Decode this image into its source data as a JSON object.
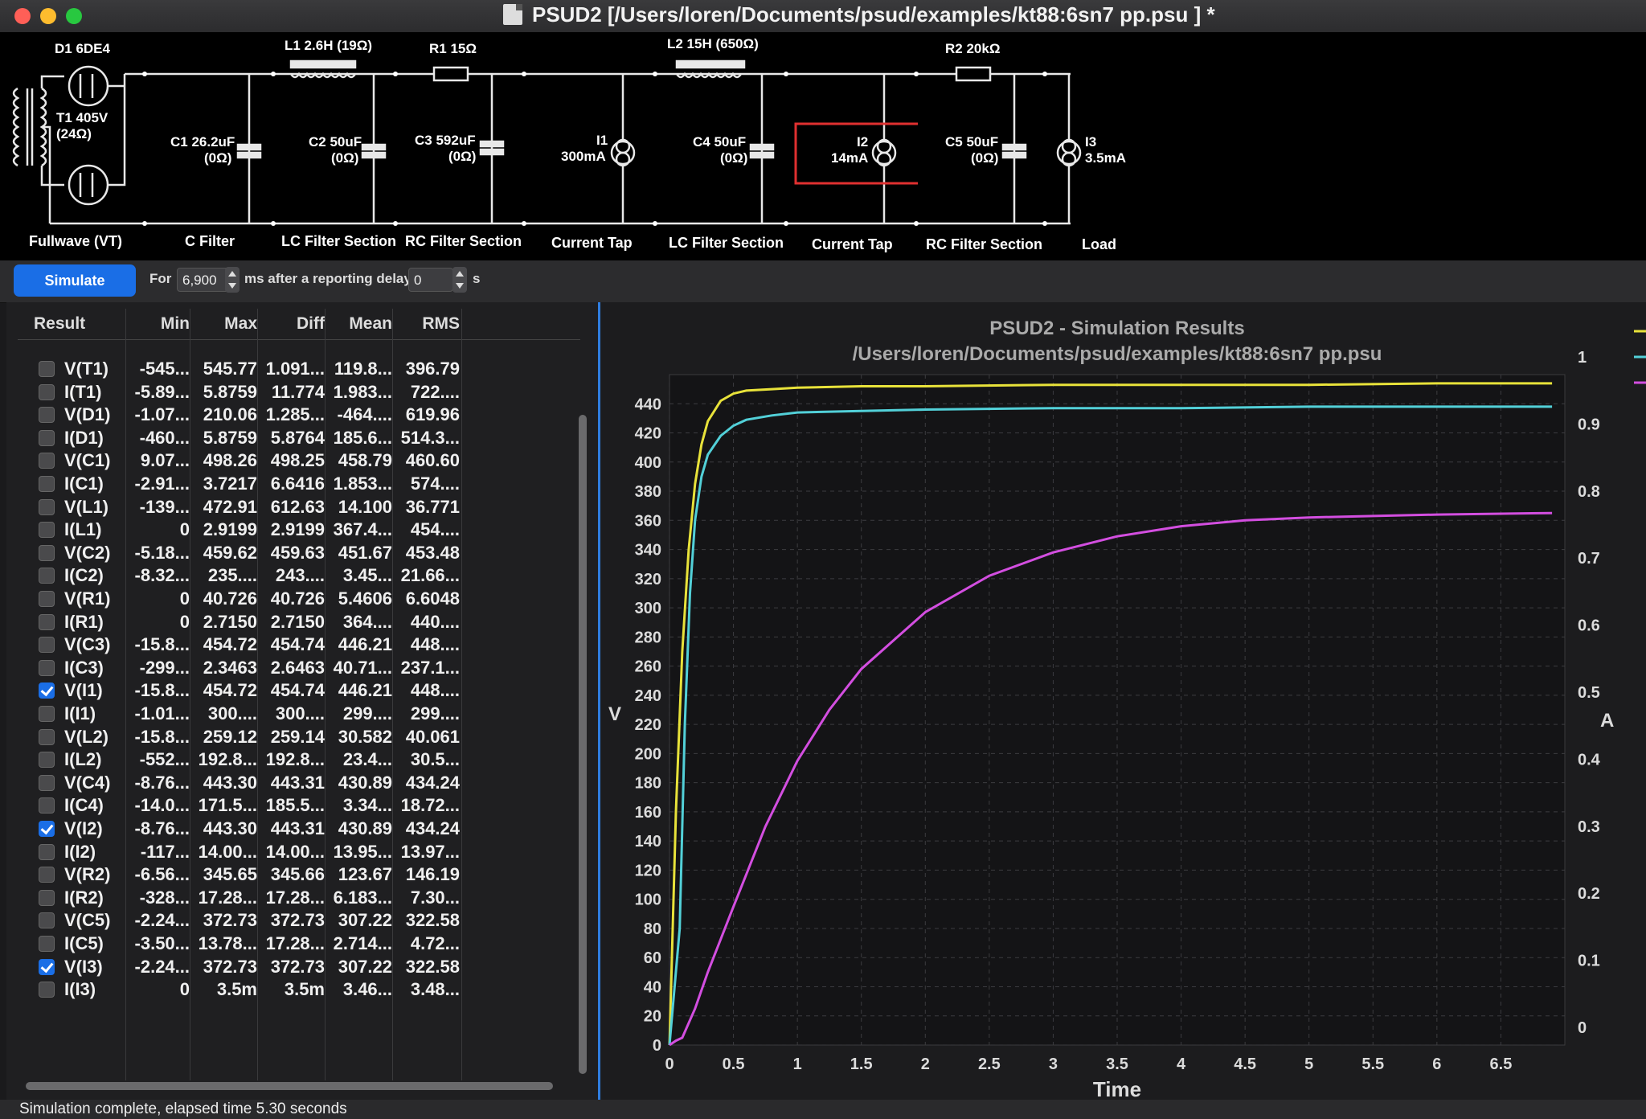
{
  "window": {
    "title": "PSUD2  [/Users/loren/Documents/psud/examples/kt88:6sn7 pp.psu ] *"
  },
  "schematic": {
    "labels": {
      "d1": "D1 6DE4",
      "t1_line1": "T1 405V",
      "t1_line2": "(24Ω)",
      "l1": "L1 2.6H (19Ω)",
      "r1": "R1 15Ω",
      "l2": "L2 15H (650Ω)",
      "r2": "R2 20kΩ",
      "c1_line1": "C1 26.2uF",
      "c1_line2": "(0Ω)",
      "c2_line1": "C2 50uF",
      "c2_line2": "(0Ω)",
      "c3_line1": "C3 592uF",
      "c3_line2": "(0Ω)",
      "i1_line1": "I1",
      "i1_line2": "300mA",
      "c4_line1": "C4 50uF",
      "c4_line2": "(0Ω)",
      "i2_line1": "I2",
      "i2_line2": "14mA",
      "c5_line1": "C5 50uF",
      "c5_line2": "(0Ω)",
      "i3_line1": "I3",
      "i3_line2": "3.5mA"
    },
    "sections": [
      "Fullwave (VT)",
      "C Filter",
      "LC Filter Section",
      "RC Filter Section",
      "Current Tap",
      "LC Filter Section",
      "Current Tap",
      "RC Filter Section",
      "Load"
    ]
  },
  "toolbar": {
    "simulate_label": "Simulate",
    "for_label": "For",
    "duration_value": "6,900",
    "ms_label": "ms after a reporting delay of",
    "delay_value": "0",
    "s_label": "s"
  },
  "table": {
    "headers": [
      "Result",
      "Min",
      "Max",
      "Diff",
      "Mean",
      "RMS"
    ],
    "rows": [
      {
        "name": "V(T1)",
        "min": "-545...",
        "max": "545.77",
        "diff": "1.091...",
        "mean": "119.8...",
        "rms": "396.79",
        "checked": false
      },
      {
        "name": "I(T1)",
        "min": "-5.89...",
        "max": "5.8759",
        "diff": "11.774",
        "mean": "1.983...",
        "rms": "722....",
        "checked": false
      },
      {
        "name": "V(D1)",
        "min": "-1.07...",
        "max": "210.06",
        "diff": "1.285...",
        "mean": "-464....",
        "rms": "619.96",
        "checked": false
      },
      {
        "name": "I(D1)",
        "min": "-460...",
        "max": "5.8759",
        "diff": "5.8764",
        "mean": "185.6...",
        "rms": "514.3...",
        "checked": false
      },
      {
        "name": "V(C1)",
        "min": "9.07...",
        "max": "498.26",
        "diff": "498.25",
        "mean": "458.79",
        "rms": "460.60",
        "checked": false
      },
      {
        "name": "I(C1)",
        "min": "-2.91...",
        "max": "3.7217",
        "diff": "6.6416",
        "mean": "1.853...",
        "rms": "574....",
        "checked": false
      },
      {
        "name": "V(L1)",
        "min": "-139...",
        "max": "472.91",
        "diff": "612.63",
        "mean": "14.100",
        "rms": "36.771",
        "checked": false
      },
      {
        "name": "I(L1)",
        "min": "0",
        "max": "2.9199",
        "diff": "2.9199",
        "mean": "367.4...",
        "rms": "454....",
        "checked": false
      },
      {
        "name": "V(C2)",
        "min": "-5.18...",
        "max": "459.62",
        "diff": "459.63",
        "mean": "451.67",
        "rms": "453.48",
        "checked": false
      },
      {
        "name": "I(C2)",
        "min": "-8.32...",
        "max": "235....",
        "diff": "243....",
        "mean": "3.45...",
        "rms": "21.66...",
        "checked": false
      },
      {
        "name": "V(R1)",
        "min": "0",
        "max": "40.726",
        "diff": "40.726",
        "mean": "5.4606",
        "rms": "6.6048",
        "checked": false
      },
      {
        "name": "I(R1)",
        "min": "0",
        "max": "2.7150",
        "diff": "2.7150",
        "mean": "364....",
        "rms": "440....",
        "checked": false
      },
      {
        "name": "V(C3)",
        "min": "-15.8...",
        "max": "454.72",
        "diff": "454.74",
        "mean": "446.21",
        "rms": "448....",
        "checked": false
      },
      {
        "name": "I(C3)",
        "min": "-299...",
        "max": "2.3463",
        "diff": "2.6463",
        "mean": "40.71...",
        "rms": "237.1...",
        "checked": false
      },
      {
        "name": "V(I1)",
        "min": "-15.8...",
        "max": "454.72",
        "diff": "454.74",
        "mean": "446.21",
        "rms": "448....",
        "checked": true
      },
      {
        "name": "I(I1)",
        "min": "-1.01...",
        "max": "300....",
        "diff": "300....",
        "mean": "299....",
        "rms": "299....",
        "checked": false
      },
      {
        "name": "V(L2)",
        "min": "-15.8...",
        "max": "259.12",
        "diff": "259.14",
        "mean": "30.582",
        "rms": "40.061",
        "checked": false
      },
      {
        "name": "I(L2)",
        "min": "-552...",
        "max": "192.8...",
        "diff": "192.8...",
        "mean": "23.4...",
        "rms": "30.5...",
        "checked": false
      },
      {
        "name": "V(C4)",
        "min": "-8.76...",
        "max": "443.30",
        "diff": "443.31",
        "mean": "430.89",
        "rms": "434.24",
        "checked": false
      },
      {
        "name": "I(C4)",
        "min": "-14.0...",
        "max": "171.5...",
        "diff": "185.5...",
        "mean": "3.34...",
        "rms": "18.72...",
        "checked": false
      },
      {
        "name": "V(I2)",
        "min": "-8.76...",
        "max": "443.30",
        "diff": "443.31",
        "mean": "430.89",
        "rms": "434.24",
        "checked": true
      },
      {
        "name": "I(I2)",
        "min": "-117...",
        "max": "14.00...",
        "diff": "14.00...",
        "mean": "13.95...",
        "rms": "13.97...",
        "checked": false
      },
      {
        "name": "V(R2)",
        "min": "-6.56...",
        "max": "345.65",
        "diff": "345.66",
        "mean": "123.67",
        "rms": "146.19",
        "checked": false
      },
      {
        "name": "I(R2)",
        "min": "-328...",
        "max": "17.28...",
        "diff": "17.28...",
        "mean": "6.183...",
        "rms": "7.30...",
        "checked": false
      },
      {
        "name": "V(C5)",
        "min": "-2.24...",
        "max": "372.73",
        "diff": "372.73",
        "mean": "307.22",
        "rms": "322.58",
        "checked": false
      },
      {
        "name": "I(C5)",
        "min": "-3.50...",
        "max": "13.78...",
        "diff": "17.28...",
        "mean": "2.714...",
        "rms": "4.72...",
        "checked": false
      },
      {
        "name": "V(I3)",
        "min": "-2.24...",
        "max": "372.73",
        "diff": "372.73",
        "mean": "307.22",
        "rms": "322.58",
        "checked": true
      },
      {
        "name": "I(I3)",
        "min": "0",
        "max": "3.5m",
        "diff": "3.5m",
        "mean": "3.46...",
        "rms": "3.48...",
        "checked": false
      }
    ]
  },
  "chart_data": {
    "type": "line",
    "title": "PSUD2 - Simulation Results",
    "subtitle": "/Users/loren/Documents/psud/examples/kt88:6sn7 pp.psu",
    "xlabel": "Time",
    "ylabel": "V",
    "y2label": "A",
    "xlim": [
      0,
      7
    ],
    "ylim": [
      0,
      460
    ],
    "y2lim": [
      0,
      1.0
    ],
    "grid": true,
    "x_ticks": [
      "0",
      "0.5",
      "1",
      "1.5",
      "2",
      "2.5",
      "3",
      "3.5",
      "4",
      "4.5",
      "5",
      "5.5",
      "6",
      "6.5"
    ],
    "y_ticks": [
      "0",
      "20",
      "40",
      "60",
      "80",
      "100",
      "120",
      "140",
      "160",
      "180",
      "200",
      "220",
      "240",
      "260",
      "280",
      "300",
      "320",
      "340",
      "360",
      "380",
      "400",
      "420",
      "440"
    ],
    "y2_ticks": [
      "0",
      "0.1",
      "0.2",
      "0.3",
      "0.4",
      "0.5",
      "0.6",
      "0.7",
      "0.8",
      "0.9",
      "1"
    ],
    "series": [
      {
        "color": "#e8e23a",
        "x": [
          0,
          0.05,
          0.1,
          0.15,
          0.2,
          0.25,
          0.3,
          0.4,
          0.5,
          0.6,
          0.8,
          1,
          1.5,
          2,
          3,
          4,
          5,
          6,
          6.9
        ],
        "y": [
          0,
          160,
          270,
          340,
          385,
          412,
          428,
          442,
          447,
          449,
          450,
          451,
          452,
          452,
          453,
          453,
          453,
          454,
          454
        ]
      },
      {
        "color": "#52d0d8",
        "x": [
          0,
          0.08,
          0.12,
          0.16,
          0.2,
          0.25,
          0.3,
          0.4,
          0.5,
          0.6,
          0.8,
          1,
          1.5,
          2,
          3,
          4,
          5,
          6,
          6.9
        ],
        "y": [
          0,
          80,
          220,
          310,
          360,
          390,
          405,
          418,
          425,
          429,
          432,
          434,
          435,
          436,
          437,
          437,
          438,
          438,
          438
        ]
      },
      {
        "color": "#d34ee0",
        "x": [
          0,
          0.05,
          0.1,
          0.2,
          0.3,
          0.5,
          0.75,
          1,
          1.25,
          1.5,
          2,
          2.5,
          3,
          3.5,
          4,
          4.5,
          5,
          5.5,
          6,
          6.9
        ],
        "y": [
          0,
          3,
          5,
          25,
          50,
          95,
          150,
          195,
          230,
          258,
          297,
          322,
          338,
          349,
          356,
          360,
          362,
          363,
          364,
          365
        ]
      }
    ]
  },
  "status": {
    "text": "Simulation complete, elapsed time 5.30 seconds"
  }
}
